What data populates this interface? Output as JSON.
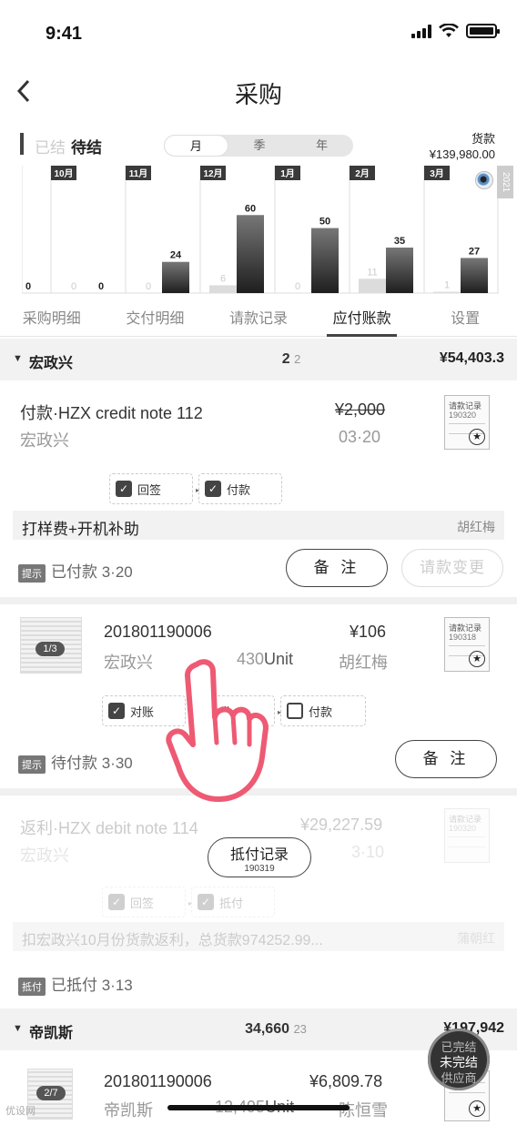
{
  "status_bar": {
    "time": "9:41"
  },
  "nav": {
    "back_icon": "chevron-left-icon",
    "title": "采购"
  },
  "summary": {
    "done_label": "已结",
    "pending_label": "待结",
    "segments": [
      "月",
      "季",
      "年"
    ],
    "active_segment": "月",
    "goods_label": "货款",
    "goods_amount": "¥139,980.00",
    "year": "2021"
  },
  "chart_data": {
    "type": "bar",
    "categories": [
      "10月",
      "11月",
      "12月",
      "1月",
      "2月",
      "3月"
    ],
    "series": [
      {
        "values": [
          0,
          0,
          6,
          0,
          11,
          1
        ],
        "color": "#dcdcdc"
      },
      {
        "values": [
          0,
          24,
          60,
          50,
          35,
          27
        ],
        "color": "#3a3a3a"
      }
    ],
    "leading_value": 0,
    "ylim": [
      0,
      70
    ]
  },
  "tabs": [
    "采购明细",
    "交付明细",
    "请款记录",
    "应付账款",
    "设置"
  ],
  "active_tab": "应付账款",
  "group1": {
    "name": "宏政兴",
    "count": "2",
    "count_small": "2",
    "amount": "¥54,403.3"
  },
  "item1": {
    "title": "付款·HZX credit note 112",
    "company": "宏政兴",
    "amount": "¥2,000",
    "date": "03·20",
    "doc_label": "请款记录",
    "doc_no": "190320",
    "checks": [
      "回签",
      "付款"
    ],
    "note": "打样费+开机补助",
    "person": "胡红梅",
    "status_tag": "提示",
    "status_text": "已付款  3·20",
    "btn_note": "备 注",
    "btn_change": "请款变更"
  },
  "item2": {
    "page": "1/3",
    "order_no": "201801190006",
    "company": "宏政兴",
    "qty": "430",
    "unit": "Unit",
    "amount": "¥106",
    "person": "胡红梅",
    "doc_label": "请款记录",
    "doc_no": "190318",
    "checks": [
      "对账",
      "发",
      "付款"
    ],
    "status_tag": "提示",
    "status_text": "待付款  3·30",
    "btn_note": "备 注"
  },
  "item3": {
    "title": "返利·HZX debit note 114",
    "company": "宏政兴",
    "amount": "¥29,227.59",
    "date": "3·10",
    "doc_label": "请款记录",
    "doc_no": "190320",
    "checks": [
      "回签",
      "抵付"
    ],
    "note": "扣宏政兴10月份货款返利，总货款974252.99...",
    "person": "蒲朝红",
    "paid_record": "抵付记录",
    "paid_record_no": "190319",
    "status_tag": "抵付",
    "status_text": "已抵付  3·13"
  },
  "group2": {
    "name": "帝凯斯",
    "count": "34,660",
    "count_small": "23",
    "amount": "¥197,942"
  },
  "item4": {
    "page": "2/7",
    "order_no": "201801190006",
    "company": "帝凯斯",
    "qty": "12,495",
    "unit": "Unit",
    "amount": "¥6,809.78",
    "person": "陈恒雪"
  },
  "float_button": {
    "top": "已完结",
    "main": "未完结",
    "bottom": "供应商"
  },
  "watermark": "优设网"
}
